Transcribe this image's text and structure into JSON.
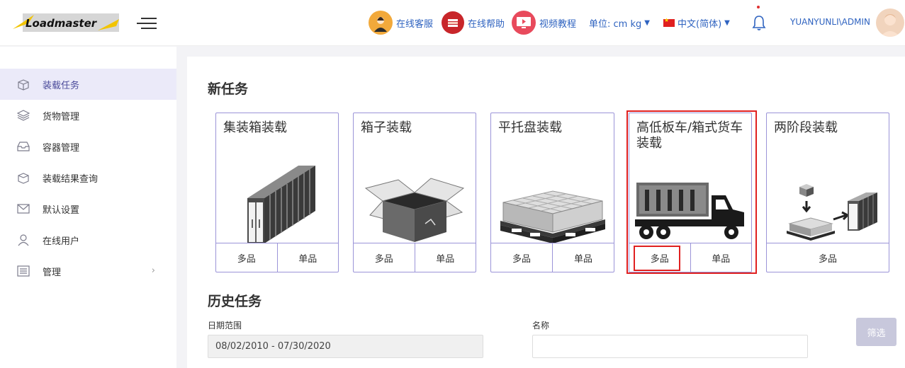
{
  "header": {
    "logo_text": "Loadmaster",
    "online_service": "在线客服",
    "online_help": "在线帮助",
    "video_tutorial": "视频教程",
    "units": "单位: cm kg",
    "language": "中文(简体)",
    "user": "YUANYUNLI\\ADMIN"
  },
  "sidebar": {
    "items": [
      {
        "label": "装载任务",
        "icon": "box-icon"
      },
      {
        "label": "货物管理",
        "icon": "layers-icon"
      },
      {
        "label": "容器管理",
        "icon": "inbox-icon"
      },
      {
        "label": "装载结果查询",
        "icon": "box-search-icon"
      },
      {
        "label": "默认设置",
        "icon": "mail-icon"
      },
      {
        "label": "在线用户",
        "icon": "user-icon"
      },
      {
        "label": "管理",
        "icon": "settings-icon"
      }
    ]
  },
  "main": {
    "new_task_title": "新任务",
    "cards": [
      {
        "title": "集装箱装载",
        "buttons": [
          "多品",
          "单品"
        ]
      },
      {
        "title": "箱子装载",
        "buttons": [
          "多品",
          "单品"
        ]
      },
      {
        "title": "平托盘装载",
        "buttons": [
          "多品",
          "单品"
        ]
      },
      {
        "title": "高低板车/箱式货车装载",
        "buttons": [
          "多品",
          "单品"
        ]
      },
      {
        "title": "两阶段装载",
        "buttons": [
          "多品"
        ]
      }
    ],
    "history_title": "历史任务",
    "date_label": "日期范围",
    "date_value": "08/02/2010 - 07/30/2020",
    "name_label": "名称",
    "filter_button": "筛选"
  },
  "colors": {
    "accent": "#9b94d8",
    "highlight": "#e02020",
    "link": "#2f63c0",
    "active_bg": "#ebeaf9"
  }
}
